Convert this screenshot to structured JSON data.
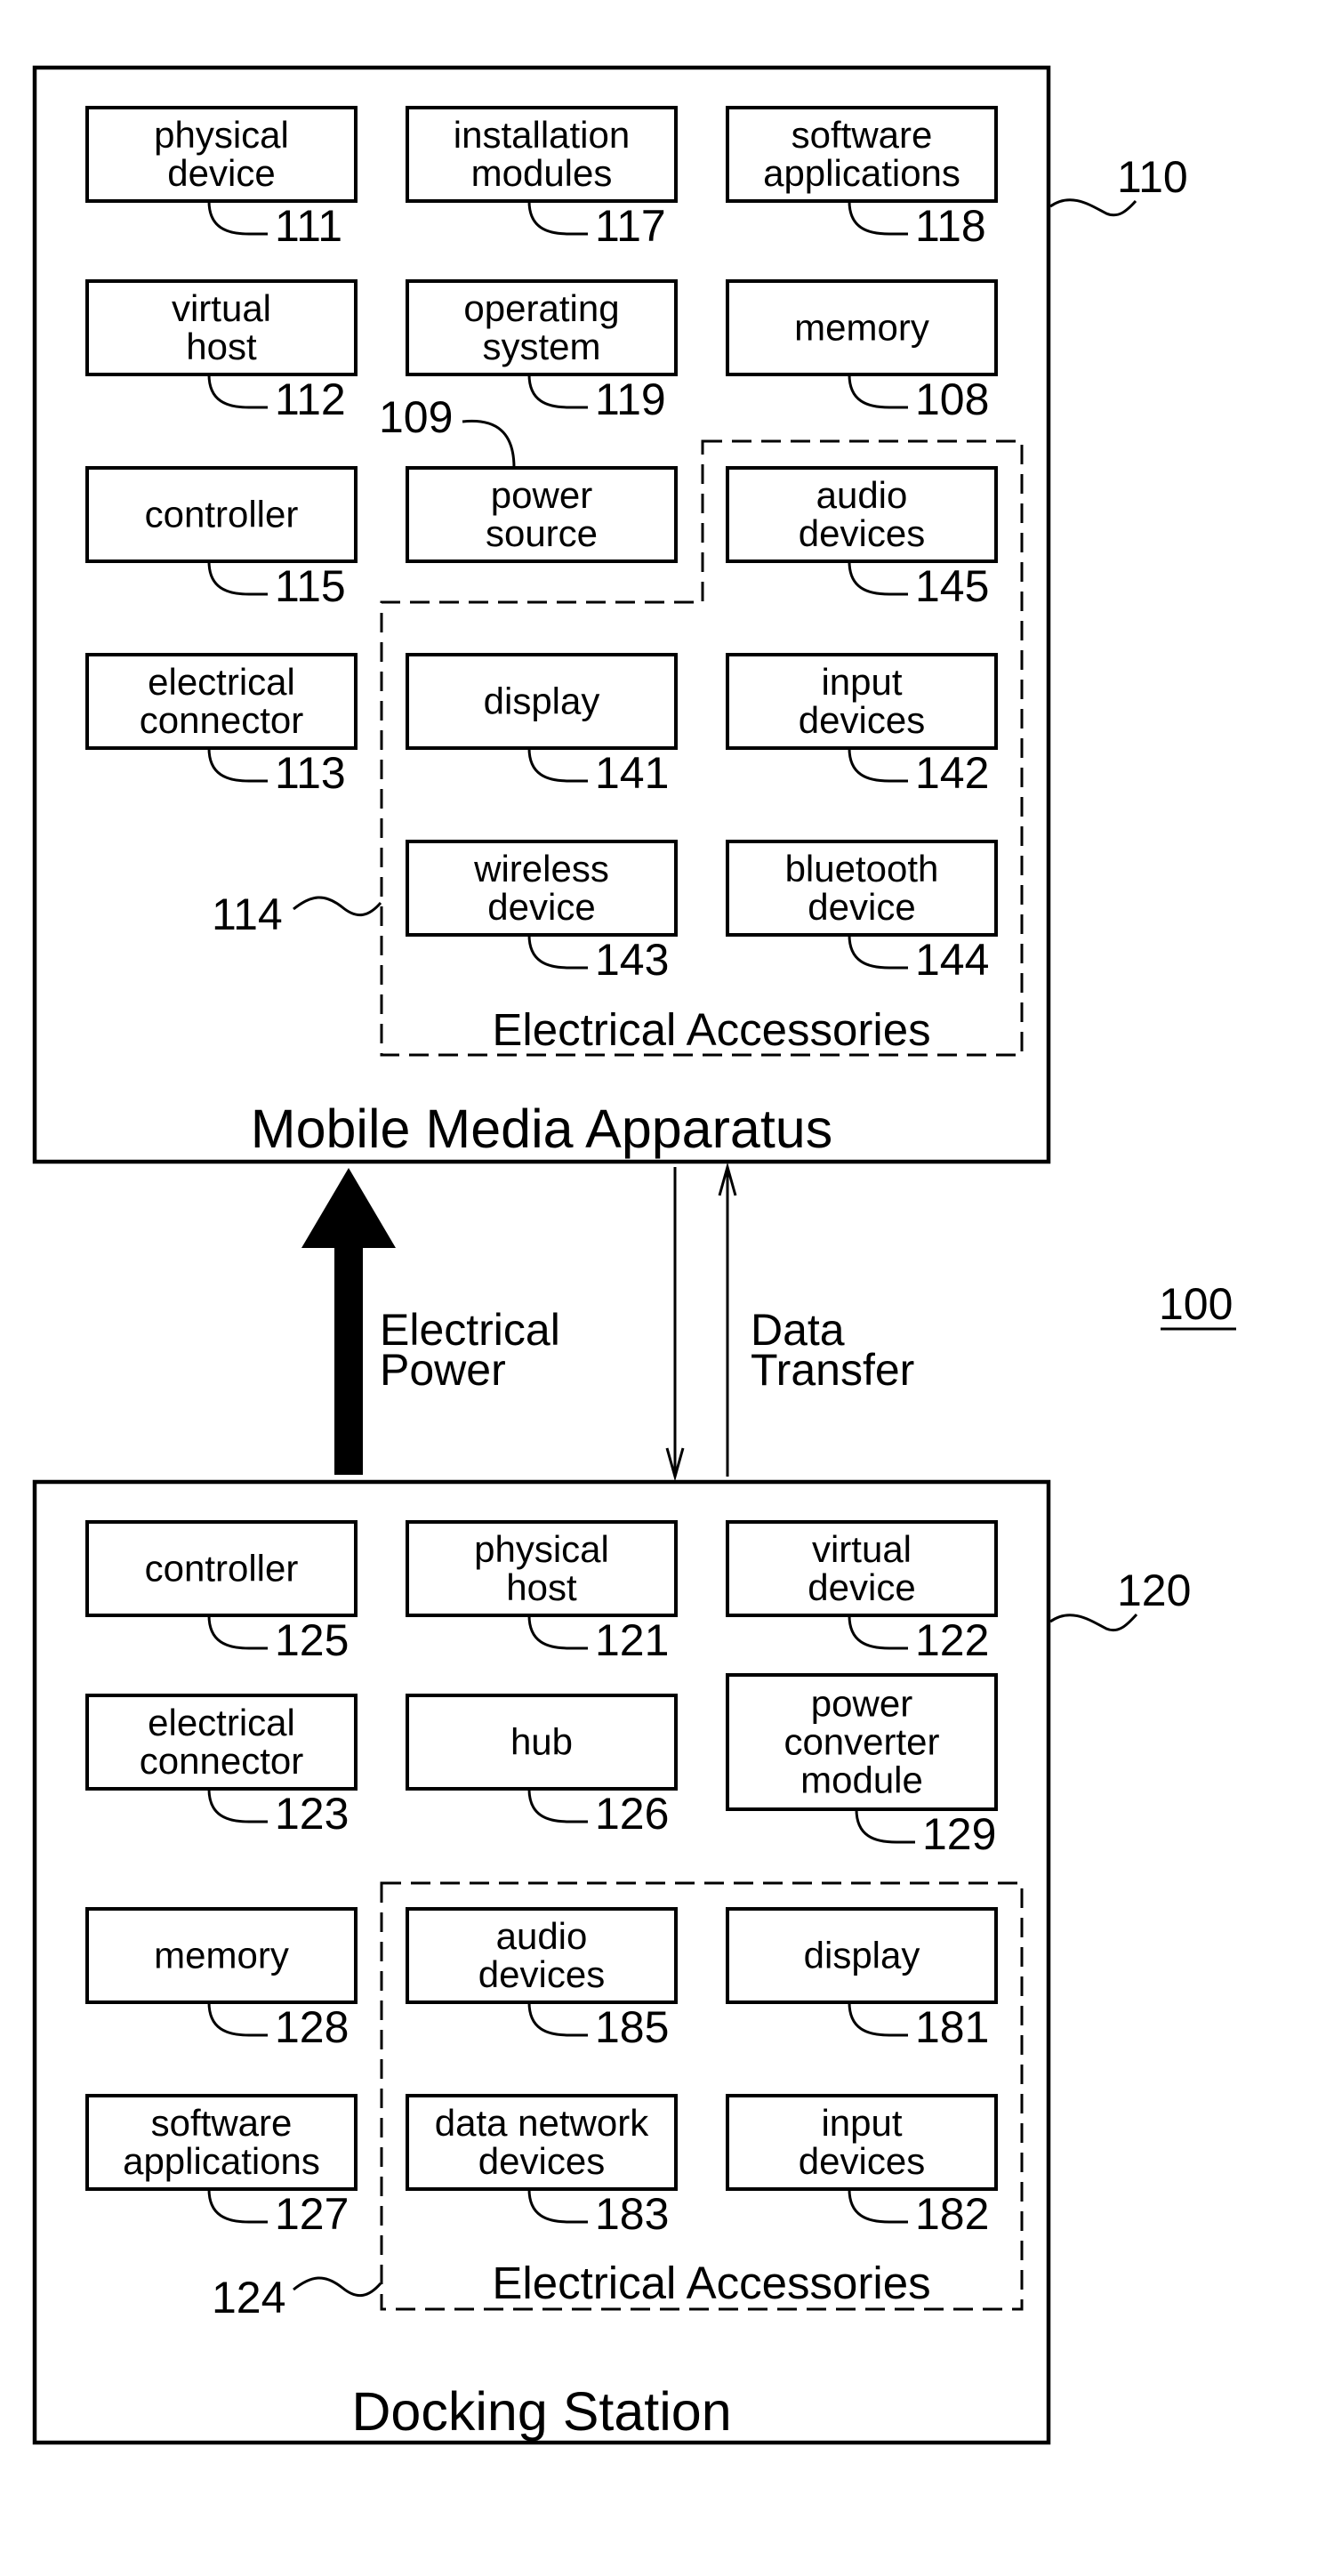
{
  "figure_ref": "100",
  "mobile_media_apparatus": {
    "title": "Mobile Media Apparatus",
    "ref": "110",
    "accessory_group": {
      "caption": "Electrical Accessories",
      "ref": "114"
    },
    "rows": [
      [
        {
          "lines": [
            "physical",
            "device"
          ],
          "ref": "111"
        },
        {
          "lines": [
            "installation",
            "modules"
          ],
          "ref": "117"
        },
        {
          "lines": [
            "software",
            "applications"
          ],
          "ref": "118"
        }
      ],
      [
        {
          "lines": [
            "virtual",
            "host"
          ],
          "ref": "112"
        },
        {
          "lines": [
            "operating",
            "system"
          ],
          "ref": "119"
        },
        {
          "lines": [
            "memory"
          ],
          "ref": "108"
        }
      ],
      [
        {
          "lines": [
            "controller"
          ],
          "ref": "115"
        },
        {
          "lines": [
            "power",
            "source"
          ],
          "ref": "109",
          "ref_style": "above-left"
        },
        {
          "lines": [
            "audio",
            "devices"
          ],
          "ref": "145",
          "accessory": true
        }
      ],
      [
        {
          "lines": [
            "electrical",
            "connector"
          ],
          "ref": "113"
        },
        {
          "lines": [
            "display"
          ],
          "ref": "141",
          "accessory": true
        },
        {
          "lines": [
            "input",
            "devices"
          ],
          "ref": "142",
          "accessory": true
        }
      ],
      [
        null,
        {
          "lines": [
            "wireless",
            "device"
          ],
          "ref": "143",
          "accessory": true
        },
        {
          "lines": [
            "bluetooth",
            "device"
          ],
          "ref": "144",
          "accessory": true
        }
      ]
    ]
  },
  "docking_station": {
    "title": "Docking Station",
    "ref": "120",
    "accessory_group": {
      "caption": "Electrical Accessories",
      "ref": "124"
    },
    "rows": [
      [
        {
          "lines": [
            "controller"
          ],
          "ref": "125"
        },
        {
          "lines": [
            "physical",
            "host"
          ],
          "ref": "121"
        },
        {
          "lines": [
            "virtual",
            "device"
          ],
          "ref": "122"
        }
      ],
      [
        {
          "lines": [
            "electrical",
            "connector"
          ],
          "ref": "123"
        },
        {
          "lines": [
            "hub"
          ],
          "ref": "126"
        },
        {
          "lines": [
            "power",
            "converter",
            "module"
          ],
          "ref": "129",
          "tall": true
        }
      ],
      [
        {
          "lines": [
            "memory"
          ],
          "ref": "128"
        },
        {
          "lines": [
            "audio",
            "devices"
          ],
          "ref": "185",
          "accessory": true
        },
        {
          "lines": [
            "display"
          ],
          "ref": "181",
          "accessory": true
        }
      ],
      [
        {
          "lines": [
            "software",
            "applications"
          ],
          "ref": "127"
        },
        {
          "lines": [
            "data network",
            "devices"
          ],
          "ref": "183",
          "accessory": true
        },
        {
          "lines": [
            "input",
            "devices"
          ],
          "ref": "182",
          "accessory": true
        }
      ]
    ]
  },
  "connections": {
    "power": {
      "label_lines": [
        "Electrical",
        "Power"
      ],
      "direction": "docking-to-mobile"
    },
    "data": {
      "label_lines": [
        "Data",
        "Transfer"
      ],
      "direction": "bidirectional"
    }
  }
}
